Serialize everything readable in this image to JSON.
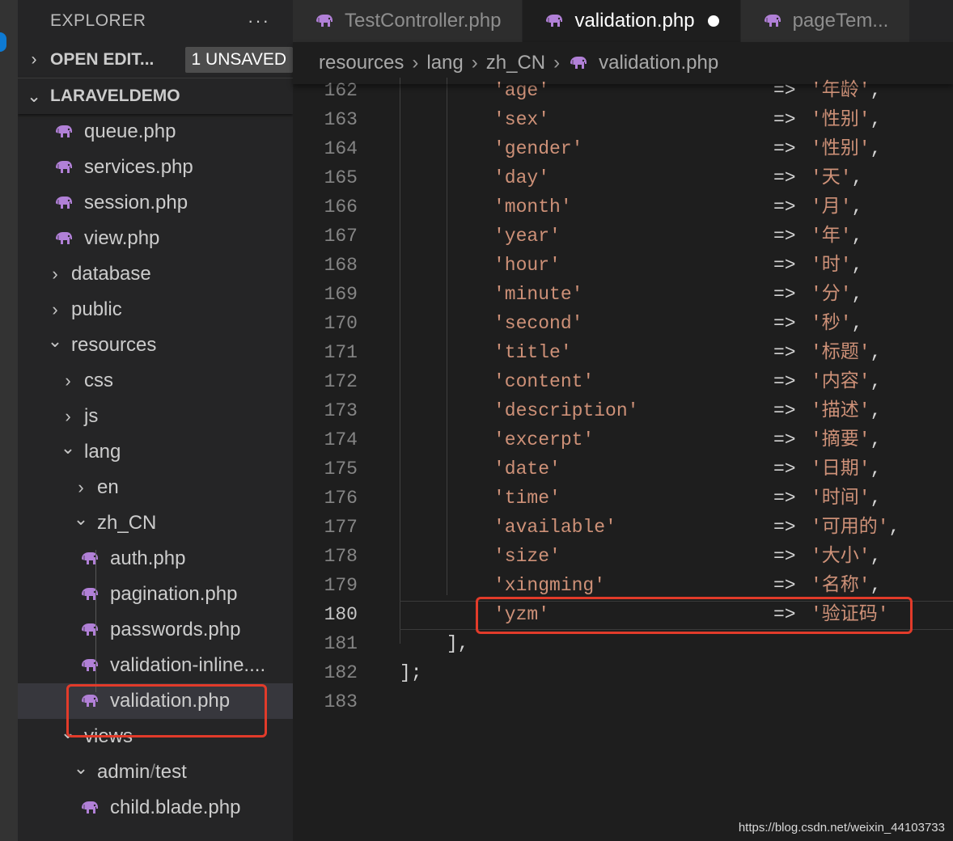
{
  "sidebar": {
    "title": "EXPLORER",
    "more": "···",
    "open_editors": {
      "label": "OPEN EDIT...",
      "badge": "1 UNSAVED"
    },
    "project": {
      "label": "LARAVELDEMO"
    },
    "items": [
      {
        "label": "queue.php",
        "kind": "file"
      },
      {
        "label": "services.php",
        "kind": "file"
      },
      {
        "label": "session.php",
        "kind": "file"
      },
      {
        "label": "view.php",
        "kind": "file"
      },
      {
        "label": "database",
        "kind": "folder-closed"
      },
      {
        "label": "public",
        "kind": "folder-closed"
      },
      {
        "label": "resources",
        "kind": "folder-open"
      },
      {
        "label": "css",
        "kind": "folder-closed"
      },
      {
        "label": "js",
        "kind": "folder-closed"
      },
      {
        "label": "lang",
        "kind": "folder-open"
      },
      {
        "label": "en",
        "kind": "folder-closed"
      },
      {
        "label": "zh_CN",
        "kind": "folder-open"
      },
      {
        "label": "auth.php",
        "kind": "file"
      },
      {
        "label": "pagination.php",
        "kind": "file"
      },
      {
        "label": "passwords.php",
        "kind": "file"
      },
      {
        "label": "validation-inline....",
        "kind": "file"
      },
      {
        "label": "validation.php",
        "kind": "file",
        "selected": true
      },
      {
        "label": "views",
        "kind": "folder-open"
      },
      {
        "label": "admin",
        "kind": "folder-open"
      },
      {
        "label": "test",
        "kind": "folder-open"
      },
      {
        "label": "child.blade.php",
        "kind": "file"
      }
    ]
  },
  "tabs": [
    {
      "label": "TestController.php",
      "active": false
    },
    {
      "label": "validation.php",
      "active": true,
      "dirty": true
    },
    {
      "label": "pageTem...",
      "active": false
    }
  ],
  "breadcrumb": [
    "resources",
    "lang",
    "zh_CN",
    "validation.php"
  ],
  "code": {
    "current_line": 180,
    "lines": [
      {
        "n": 162,
        "key": "'age'",
        "arrow": "=>",
        "val": "'年龄',",
        "partial": true
      },
      {
        "n": 163,
        "key": "'sex'",
        "arrow": "=>",
        "val": "'性别',"
      },
      {
        "n": 164,
        "key": "'gender'",
        "arrow": "=>",
        "val": "'性别',"
      },
      {
        "n": 165,
        "key": "'day'",
        "arrow": "=>",
        "val": "'天',"
      },
      {
        "n": 166,
        "key": "'month'",
        "arrow": "=>",
        "val": "'月',"
      },
      {
        "n": 167,
        "key": "'year'",
        "arrow": "=>",
        "val": "'年',"
      },
      {
        "n": 168,
        "key": "'hour'",
        "arrow": "=>",
        "val": "'时',"
      },
      {
        "n": 169,
        "key": "'minute'",
        "arrow": "=>",
        "val": "'分',"
      },
      {
        "n": 170,
        "key": "'second'",
        "arrow": "=>",
        "val": "'秒',"
      },
      {
        "n": 171,
        "key": "'title'",
        "arrow": "=>",
        "val": "'标题',"
      },
      {
        "n": 172,
        "key": "'content'",
        "arrow": "=>",
        "val": "'内容',"
      },
      {
        "n": 173,
        "key": "'description'",
        "arrow": "=>",
        "val": "'描述',"
      },
      {
        "n": 174,
        "key": "'excerpt'",
        "arrow": "=>",
        "val": "'摘要',"
      },
      {
        "n": 175,
        "key": "'date'",
        "arrow": "=>",
        "val": "'日期',"
      },
      {
        "n": 176,
        "key": "'time'",
        "arrow": "=>",
        "val": "'时间',"
      },
      {
        "n": 177,
        "key": "'available'",
        "arrow": "=>",
        "val": "'可用的',"
      },
      {
        "n": 178,
        "key": "'size'",
        "arrow": "=>",
        "val": "'大小',"
      },
      {
        "n": 179,
        "key": "'xingming'",
        "arrow": "=>",
        "val": "'名称',"
      },
      {
        "n": 180,
        "key": "'yzm'",
        "arrow": "=>",
        "val": "'验证码'"
      },
      {
        "n": 181,
        "plain": "],",
        "indent": 190
      },
      {
        "n": 182,
        "plain": "];",
        "indent": 132
      },
      {
        "n": 183,
        "plain": ""
      }
    ]
  },
  "watermark": "https://blog.csdn.net/weixin_44103733",
  "colors": {
    "highlight": "#e23b2a",
    "php_icon": "#b180d7",
    "string": "#ce9178"
  }
}
